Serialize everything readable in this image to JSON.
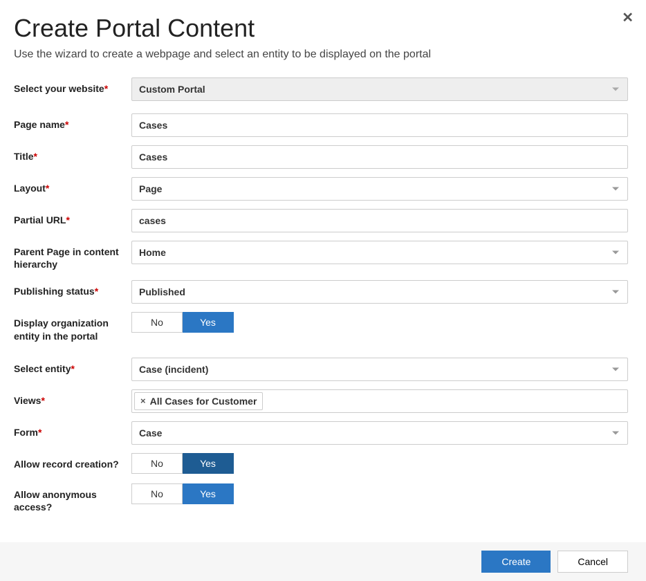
{
  "dialog": {
    "title": "Create Portal Content",
    "subtitle": "Use the wizard to create a webpage and select an entity to be displayed on the portal"
  },
  "labels": {
    "website": "Select your website",
    "page_name": "Page name",
    "title": "Title",
    "layout": "Layout",
    "partial_url": "Partial URL",
    "parent_page": "Parent Page in content hierarchy",
    "publishing_status": "Publishing status",
    "display_org": "Display organization entity in the portal",
    "select_entity": "Select entity",
    "views": "Views",
    "form": "Form",
    "allow_record": "Allow record creation?",
    "allow_anon": "Allow anonymous access?"
  },
  "values": {
    "website": "Custom Portal",
    "page_name": "Cases",
    "title": "Cases",
    "layout": "Page",
    "partial_url": "cases",
    "parent_page": "Home",
    "publishing_status": "Published",
    "select_entity": "Case (incident)",
    "views_tag": "All Cases for Customer",
    "form": "Case"
  },
  "toggle": {
    "no": "No",
    "yes": "Yes"
  },
  "footer": {
    "create": "Create",
    "cancel": "Cancel"
  }
}
